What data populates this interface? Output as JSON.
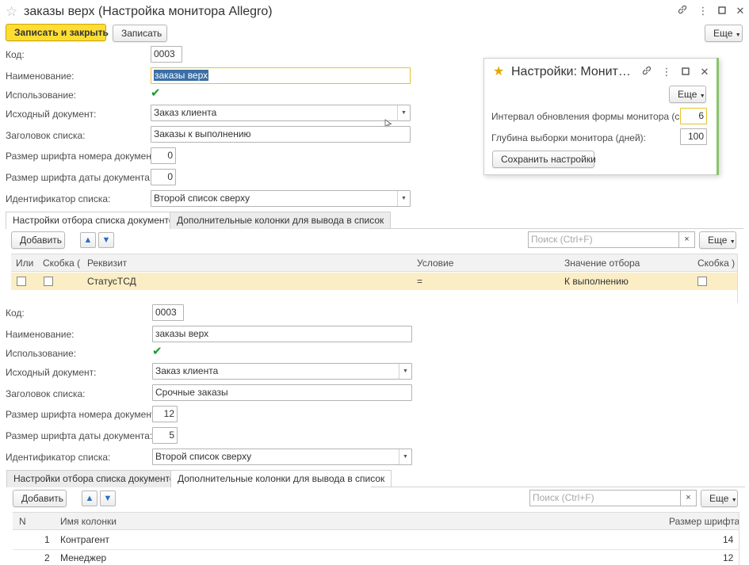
{
  "window": {
    "title": "заказы верх (Настройка монитора Allegro)",
    "icons": {
      "favorite": "star-outline-icon",
      "link": "link-icon",
      "menu": "more-vertical-icon",
      "maximize": "maximize-icon",
      "close": "close-icon"
    }
  },
  "toolbar": {
    "save_close_label": "Записать и закрыть",
    "save_label": "Записать",
    "more_label": "Еще"
  },
  "form1": {
    "code_label": "Код:",
    "code_value": "0003",
    "name_label": "Наименование:",
    "name_value": "заказы верх",
    "use_label": "Использование:",
    "source_label": "Исходный документ:",
    "source_value": "Заказ клиента",
    "header_label": "Заголовок списка:",
    "header_value": "Заказы к выполнению",
    "docnum_font_label": "Размер шрифта номера документа:",
    "docnum_font_value": "0",
    "docdate_font_label": "Размер шрифта даты документа:",
    "docdate_font_value": "0",
    "list_id_label": "Идентификатор списка:",
    "list_id_value": "Второй список сверху",
    "tabs": [
      "Настройки отбора списка документов",
      "Дополнительные колонки для вывода в список"
    ],
    "add_label": "Добавить",
    "search_placeholder": "Поиск (Ctrl+F)",
    "search_clear": "×",
    "more_label": "Еще",
    "columns": [
      "Или",
      "Скобка (",
      "Реквизит",
      "Условие",
      "Значение отбора",
      "Скобка )"
    ],
    "rows": [
      {
        "attribute": "СтатусТСД",
        "condition": "=",
        "value": "К выполнению"
      }
    ]
  },
  "popup": {
    "title": "Настройки: Монит…",
    "more_label": "Еще",
    "interval_label": "Интервал обновления формы монитора (сек.):",
    "interval_value": "6",
    "depth_label": "Глубина выборки монитора (дней):",
    "depth_value": "100",
    "save_label": "Сохранить настройки"
  },
  "form2": {
    "code_label": "Код:",
    "code_value": "0003",
    "name_label": "Наименование:",
    "name_value": "заказы верх",
    "use_label": "Использование:",
    "source_label": "Исходный документ:",
    "source_value": "Заказ клиента",
    "header_label": "Заголовок списка:",
    "header_value": "Срочные заказы",
    "docnum_font_label": "Размер шрифта номера документа:",
    "docnum_font_value": "12",
    "docdate_font_label": "Размер шрифта даты документа:",
    "docdate_font_value": "5",
    "list_id_label": "Идентификатор списка:",
    "list_id_value": "Второй список сверху",
    "tabs": [
      "Настройки отбора списка документов",
      "Дополнительные колонки для вывода в список"
    ],
    "add_label": "Добавить",
    "search_placeholder": "Поиск (Ctrl+F)",
    "search_clear": "×",
    "more_label": "Еще",
    "columns": [
      "N",
      "Имя колонки",
      "Размер шрифта"
    ],
    "rows": [
      {
        "n": "1",
        "name": "Контрагент",
        "size": "14"
      },
      {
        "n": "2",
        "name": "Менеджер",
        "size": "12"
      }
    ]
  },
  "colors": {
    "primary_button": "#ffdd33",
    "selected_row": "#fbeec5",
    "check": "#1a9c2a",
    "arrow_icon": "#2c6fc2",
    "popup_accent": "#8ac36b",
    "star_active": "#e6a800"
  }
}
